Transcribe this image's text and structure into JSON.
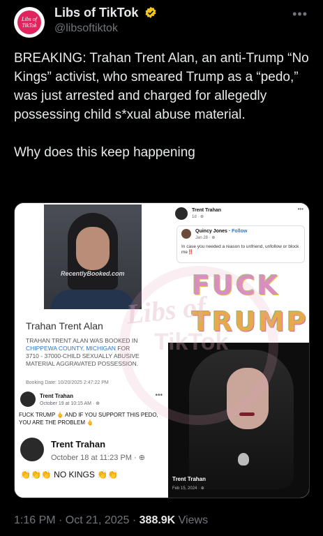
{
  "header": {
    "display_name": "Libs of TikTok",
    "handle": "@libsoftiktok",
    "avatar_text": "Libs of TikTok",
    "more_icon": "ellipsis-icon",
    "verified_color": "#f4c51c"
  },
  "tweet": {
    "text_main": "BREAKING: Trahan Trent Alan, an anti-Trump “No Kings” activist, who smeared Trump as a “pedo,” was just arrested and charged for allegedly possessing child s*xual abuse material.",
    "text_question": "Why does this keep happening"
  },
  "media": {
    "mugshot_watermark": "RecentlyBooked.com",
    "booking_name": "Trahan Trent Alan",
    "booking_line1": "TRAHAN TRENT ALAN WAS BOOKED IN",
    "booking_county": "CHIPPEWA COUNTY, MICHIGAN",
    "booking_line2": " FOR",
    "booking_line3": "3710 - 37000-CHILD SEXUALLY ABUSIVE MATERIAL AGGRAVATED POSSESSION.",
    "booking_date": "Booking Date: 10/20/2025 2:47:22 PM",
    "post1": {
      "name": "Trent Trahan",
      "meta": "October 19 at 10:15 AM · ",
      "body": "FUCK TRUMP 🖕 AND IF YOU SUPPORT THIS PEDO, YOU ARE THE PROBLEM 🖕"
    },
    "post2": {
      "name": "Trent Trahan",
      "meta": "October 18 at 11:23 PM · ",
      "body": "👏👏👏 NO KINGS 👏👏"
    },
    "fb_top": {
      "name": "Trent Trahan",
      "meta": "1d · "
    },
    "quote": {
      "name": "Quincy Jones",
      "follow": "Follow",
      "meta": "Jan 28 · ",
      "body": "In case you needed a reason to unfriend, unfollow or block me‼️"
    },
    "flower_text_1": "FUCK",
    "flower_text_2": "TRUMP",
    "photo_name": "Trent Trahan",
    "photo_meta": "Feb 15, 2024 · ",
    "watermark_1": "Libs of",
    "watermark_2": "TikTok"
  },
  "footer": {
    "time": "1:16 PM · Oct 21, 2025 · ",
    "views_count": "388.9K",
    "views_label": " Views"
  }
}
